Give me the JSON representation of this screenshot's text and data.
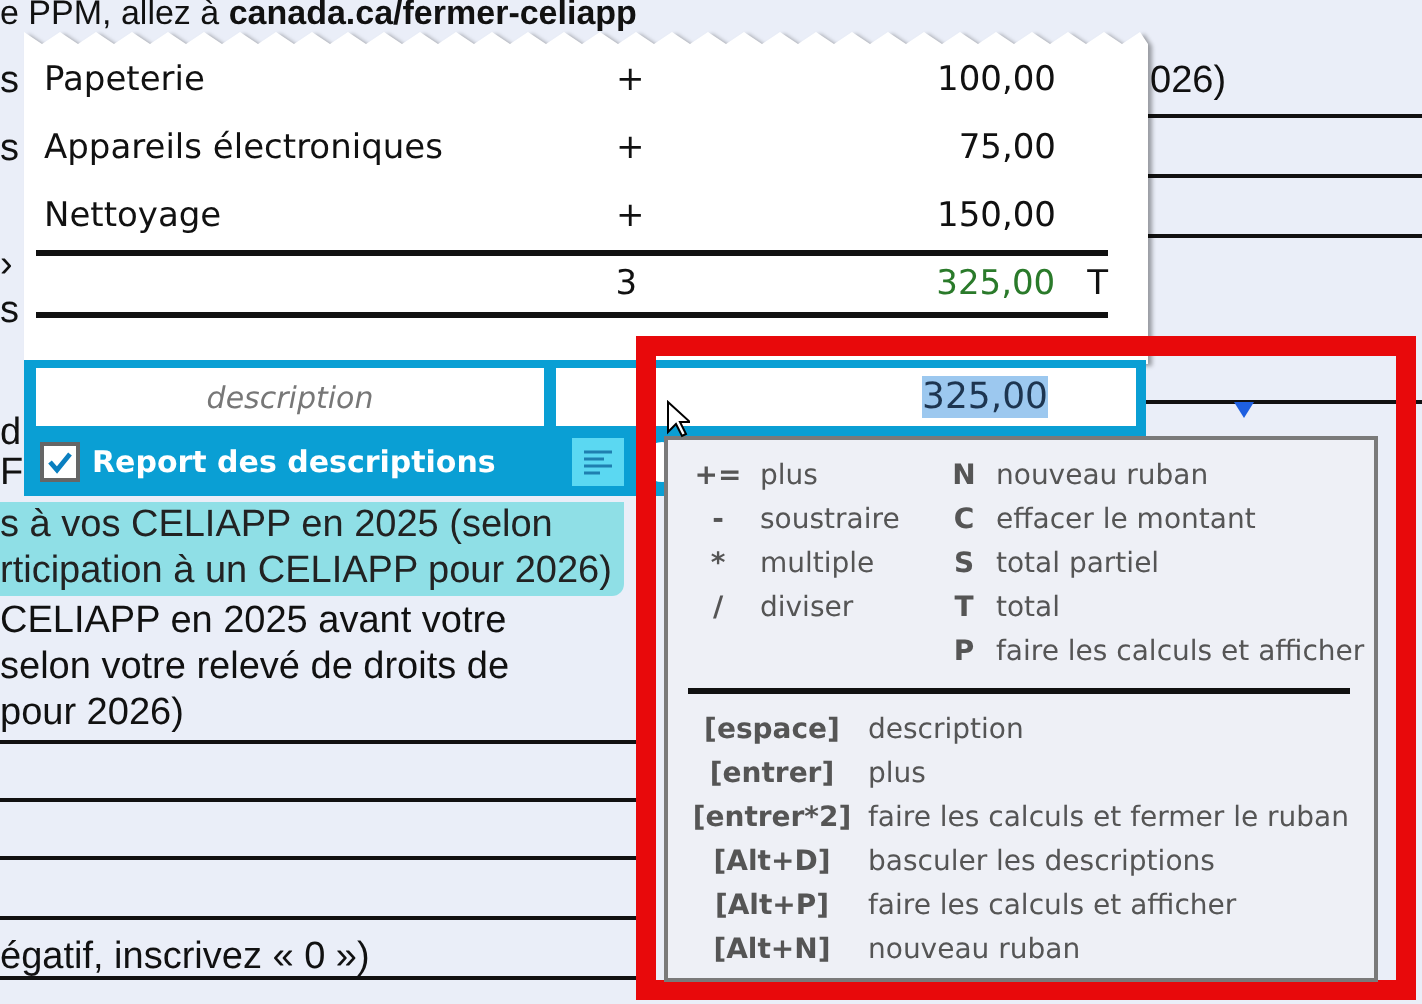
{
  "document": {
    "heading": "e PPM, allez à **canada.ca/fermer-celiapp**",
    "fragments": [
      "s",
      "026)",
      "s",
      "›",
      "s",
      "d",
      "F"
    ],
    "highlighted_lines": [
      "s à vos CELIAPP en 2025 (selon",
      "rticipation à un CELIAPP pour 2026)"
    ],
    "paragraph_lines": [
      "CELIAPP en 2025 avant votre",
      "selon votre relevé de droits de",
      "pour 2026)"
    ],
    "footer_line": "égatif, inscrivez « 0 »)"
  },
  "tape": {
    "rows": [
      {
        "description": "Papeterie",
        "operator": "+",
        "amount": "100,00"
      },
      {
        "description": "Appareils électroniques",
        "operator": "+",
        "amount": "75,00"
      },
      {
        "description": "Nettoyage",
        "operator": "+",
        "amount": "150,00"
      }
    ],
    "total": {
      "count": "3",
      "amount": "325,00",
      "flag": "T"
    },
    "description_field": {
      "placeholder": "description"
    },
    "amount_field": {
      "value": "325,00",
      "selected": true
    },
    "carry_descriptions": {
      "label": "Report des descriptions",
      "checked": true
    },
    "descriptions_toggle": {
      "on": true
    }
  },
  "help": {
    "operators": [
      {
        "key": "+=",
        "label": "plus"
      },
      {
        "key": "-",
        "label": "soustraire"
      },
      {
        "key": "*",
        "label": "multiple"
      },
      {
        "key": "/",
        "label": "diviser"
      }
    ],
    "commands": [
      {
        "key": "N",
        "label": "nouveau ruban"
      },
      {
        "key": "C",
        "label": "effacer le montant"
      },
      {
        "key": "S",
        "label": "total partiel"
      },
      {
        "key": "T",
        "label": "total"
      },
      {
        "key": "P",
        "label": "faire les calculs et afficher"
      }
    ],
    "shortcuts": [
      {
        "key": "[espace]",
        "label": "description"
      },
      {
        "key": "[entrer]",
        "label": "plus"
      },
      {
        "key": "[entrer*2]",
        "label": "faire les calculs et fermer le ruban"
      },
      {
        "key": "[Alt+D]",
        "label": "basculer les descriptions"
      },
      {
        "key": "[Alt+P]",
        "label": "faire les calculs et afficher"
      },
      {
        "key": "[Alt+N]",
        "label": "nouveau ruban"
      }
    ]
  }
}
